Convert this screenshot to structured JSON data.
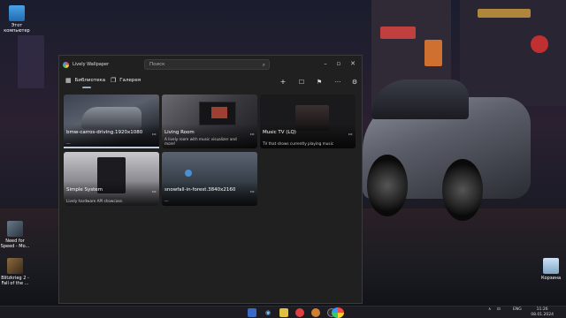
{
  "desktop": {
    "icons": [
      {
        "label": "Этот компьютер"
      },
      {
        "label": "Need for Speed - Mo..."
      },
      {
        "label": "Blitzkrieg 2 - Fall of the ..."
      },
      {
        "label": "Корзина"
      }
    ]
  },
  "app": {
    "title": "Lively Wallpaper",
    "search_placeholder": "Поиск",
    "nav": [
      {
        "label": "Библиотека",
        "icon": "grid-icon"
      },
      {
        "label": "Галерея",
        "icon": "gallery-icon"
      }
    ],
    "tools": [
      "+",
      "☐",
      "⚑",
      "···",
      "⚙"
    ],
    "wallpapers": [
      {
        "title": "bmw-carros-driving.1920x1080",
        "desc": "---",
        "thumb": "car"
      },
      {
        "title": "Living Room",
        "desc": "A lively room with music visualizer and more!",
        "thumb": "room"
      },
      {
        "title": "Music TV (LQ)",
        "desc": "TV that shows currently playing music",
        "thumb": "tv"
      },
      {
        "title": "Simple System",
        "desc": "Lively hardware API showcase.",
        "thumb": "pc"
      },
      {
        "title": "snowfall-in-forest.3840x2160",
        "desc": "---",
        "thumb": "forest"
      }
    ],
    "more_label": "···"
  },
  "taskbar": {
    "tray": [
      "∧",
      "⊡",
      "ENG"
    ],
    "time": "11:26",
    "date": "08.01.2024"
  }
}
